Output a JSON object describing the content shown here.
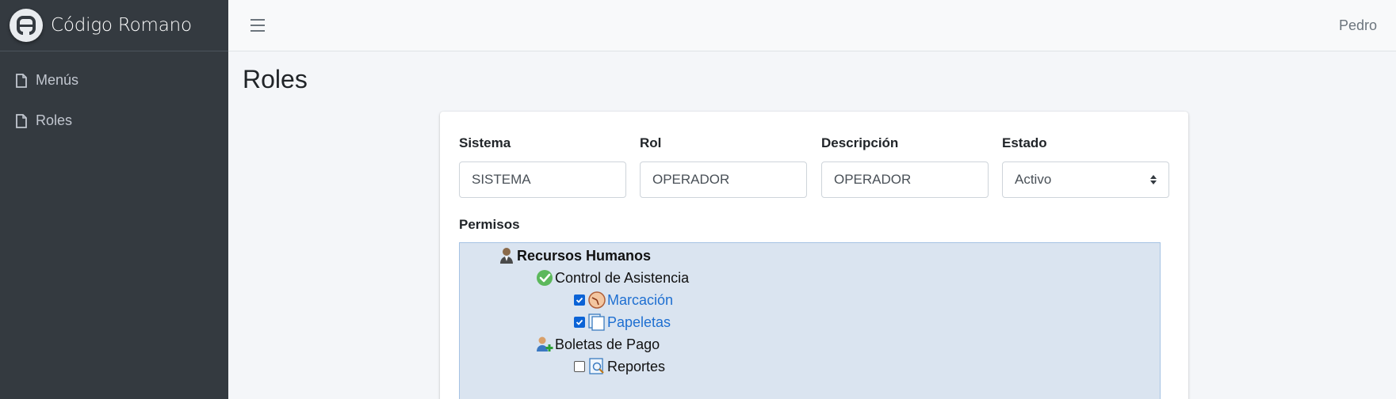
{
  "app": {
    "brand": "Código Romano",
    "user": "Pedro"
  },
  "sidebar": {
    "items": [
      {
        "label": "Menús"
      },
      {
        "label": "Roles"
      }
    ]
  },
  "page": {
    "title": "Roles"
  },
  "form": {
    "sistema": {
      "label": "Sistema",
      "value": "SISTEMA"
    },
    "rol": {
      "label": "Rol",
      "value": "OPERADOR"
    },
    "descripcion": {
      "label": "Descripción",
      "value": "OPERADOR"
    },
    "estado": {
      "label": "Estado",
      "value": "Activo"
    },
    "permisos_label": "Permisos"
  },
  "tree": {
    "root": {
      "label": "Recursos Humanos",
      "icon": "user-icon"
    },
    "control": {
      "label": "Control de Asistencia",
      "icon": "check-circle-icon"
    },
    "marcacion": {
      "label": "Marcación",
      "icon": "clock-icon",
      "checked": true
    },
    "papeletas": {
      "label": "Papeletas",
      "icon": "documents-icon",
      "checked": true
    },
    "boletas": {
      "label": "Boletas de Pago",
      "icon": "user-add-icon"
    },
    "reportes": {
      "label": "Reportes",
      "icon": "report-icon",
      "checked": false
    }
  },
  "colors": {
    "sidebar": "#343a40",
    "tree_bg": "#dae4f0",
    "link": "#1e6fd1",
    "checkbox": "#0b63d6"
  }
}
